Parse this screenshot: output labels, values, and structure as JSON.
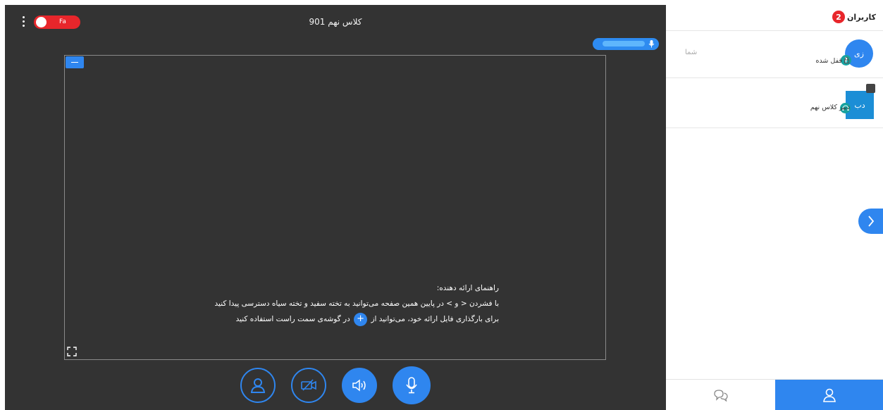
{
  "class": {
    "title": "کلاس نهم 901",
    "lang_toggle_label": "Fa"
  },
  "guide": {
    "heading": "راهنمای ارائه دهنده:",
    "line1": "با فشردن < و > در پایین همین صفحه می‌توانید به تخته سفید و تخته سیاه دسترسی پیدا کنید",
    "line2_before": "برای بارگذاری فایل ارائه خود، می‌توانید از",
    "line2_after": "در گوشه‌ی سمت راست استفاده کنید",
    "plus_glyph": "+"
  },
  "sidebar": {
    "header": {
      "title": "کاربران",
      "count": "2"
    },
    "users": [
      {
        "initials": "زی",
        "you_label": "شما",
        "status": "قفل شده"
      },
      {
        "initials": "دب",
        "status": "دبیر کلاس نهم"
      }
    ]
  },
  "icons": {
    "kebab": "kebab-menu-icon",
    "fullscreen": "fullscreen-icon",
    "user": "user-icon",
    "camera": "camera-off-icon",
    "speaker": "speaker-icon",
    "mic": "microphone-icon",
    "chat": "chat-icon",
    "lock": "lock-icon",
    "headset": "headset-icon",
    "whiteboard": "whiteboard-icon",
    "chevron": "chevron-right-icon"
  },
  "colors": {
    "accent": "#2f86ef",
    "danger": "#e8262b",
    "stage": "#333333"
  }
}
